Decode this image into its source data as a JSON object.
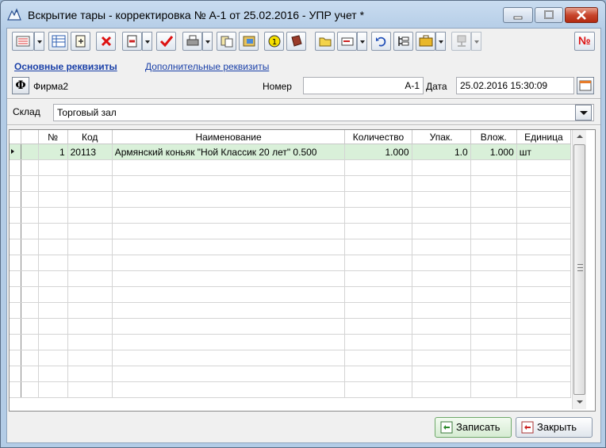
{
  "window": {
    "title": "Вскрытие тары - корректировка № А-1 от 25.02.2016 - УПР учет *"
  },
  "toolbar": {
    "buttons": [
      "list-icon",
      "table-icon",
      "copy-icon",
      "delete-icon",
      "document-icon",
      "check-icon",
      "print-icon",
      "clipboard-icon",
      "chart-icon",
      "coin-icon",
      "book-icon",
      "folder-icon",
      "mail-icon",
      "undo-icon",
      "structure-icon",
      "briefcase-icon",
      "network-icon",
      "number-icon"
    ],
    "number_button": "№"
  },
  "tabs": {
    "main": "Основные реквизиты",
    "extra": "Дополнительные реквизиты"
  },
  "header": {
    "firm_button": "Ф",
    "firm": "Фирма2",
    "number_label": "Номер",
    "number_value": "А-1",
    "date_label": "Дата",
    "date_value": "25.02.2016 15:30:09"
  },
  "warehouse": {
    "label": "Склад",
    "value": "Торговый зал"
  },
  "table": {
    "columns": [
      "№",
      "Код",
      "Наименование",
      "Количество",
      "Упак.",
      "Влож.",
      "Единица"
    ],
    "rows": [
      [
        "1",
        "20113",
        "Армянский коньяк \"Ной Классик 20 лет\" 0.500",
        "1.000",
        "1.0",
        "1.000",
        "шт"
      ]
    ]
  },
  "footer": {
    "save": "Записать",
    "close": "Закрыть"
  },
  "colors": {
    "selected_row": "#d9f0d9",
    "link": "#1a40a8",
    "close_button": "#c7452c"
  }
}
